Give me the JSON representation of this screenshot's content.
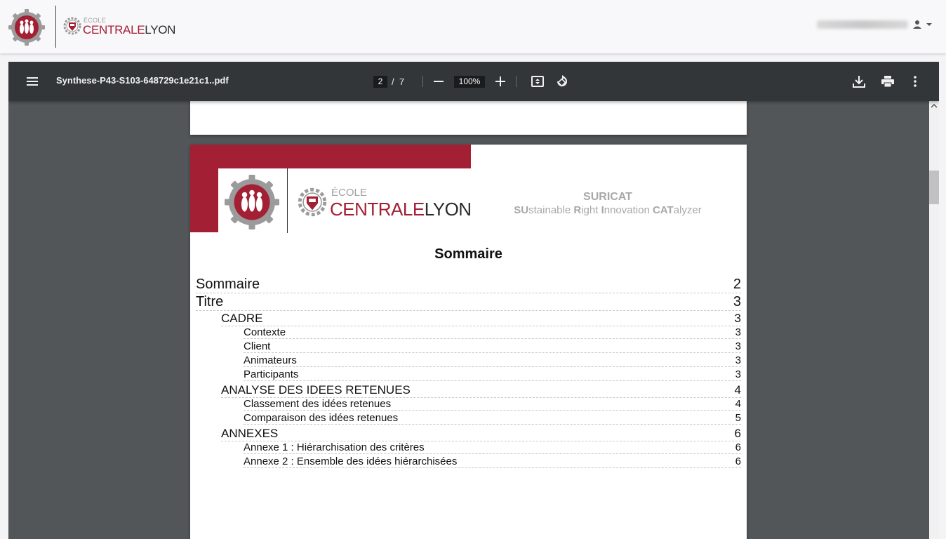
{
  "header": {
    "logo_small": "ÉCOLE",
    "logo_main": "CENTRALE",
    "logo_city": "LYON"
  },
  "viewer": {
    "filename": "Synthese-P43-S103-648729c1e21c1..pdf",
    "current_page": "2",
    "page_separator": "/",
    "total_pages": "7",
    "zoom": "100%"
  },
  "document": {
    "logo_small": "ÉCOLE",
    "logo_main": "CENTRALE",
    "logo_city": "LYON",
    "suricat_title": "SURICAT",
    "suricat_subtitle": "SUstainable Right Innovation CATalyzer",
    "toc_title": "Sommaire",
    "toc": [
      {
        "label": "Sommaire",
        "page": "2"
      },
      {
        "label": "Titre",
        "page": "3"
      },
      {
        "label": "CADRE",
        "page": "3"
      },
      {
        "label": "Contexte",
        "page": "3"
      },
      {
        "label": "Client",
        "page": "3"
      },
      {
        "label": "Animateurs",
        "page": "3"
      },
      {
        "label": "Participants",
        "page": "3"
      },
      {
        "label": "ANALYSE DES IDEES RETENUES",
        "page": "4"
      },
      {
        "label": "Classement des idées retenues",
        "page": "4"
      },
      {
        "label": "Comparaison des idées retenues",
        "page": "5"
      },
      {
        "label": "ANNEXES",
        "page": "6"
      },
      {
        "label": "Annexe 1 : Hiérarchisation des critères",
        "page": "6"
      },
      {
        "label": "Annexe 2 : Ensemble des idées hiérarchisées",
        "page": "6"
      }
    ]
  },
  "colors": {
    "brand": "#a31f34",
    "toolbar": "#323639",
    "viewer_bg": "#525659"
  },
  "icons": [
    "menu-icon",
    "zoom-out-icon",
    "zoom-in-icon",
    "fit-page-icon",
    "rotate-icon",
    "download-icon",
    "print-icon",
    "more-options-icon",
    "user-icon",
    "caret-down-icon"
  ]
}
